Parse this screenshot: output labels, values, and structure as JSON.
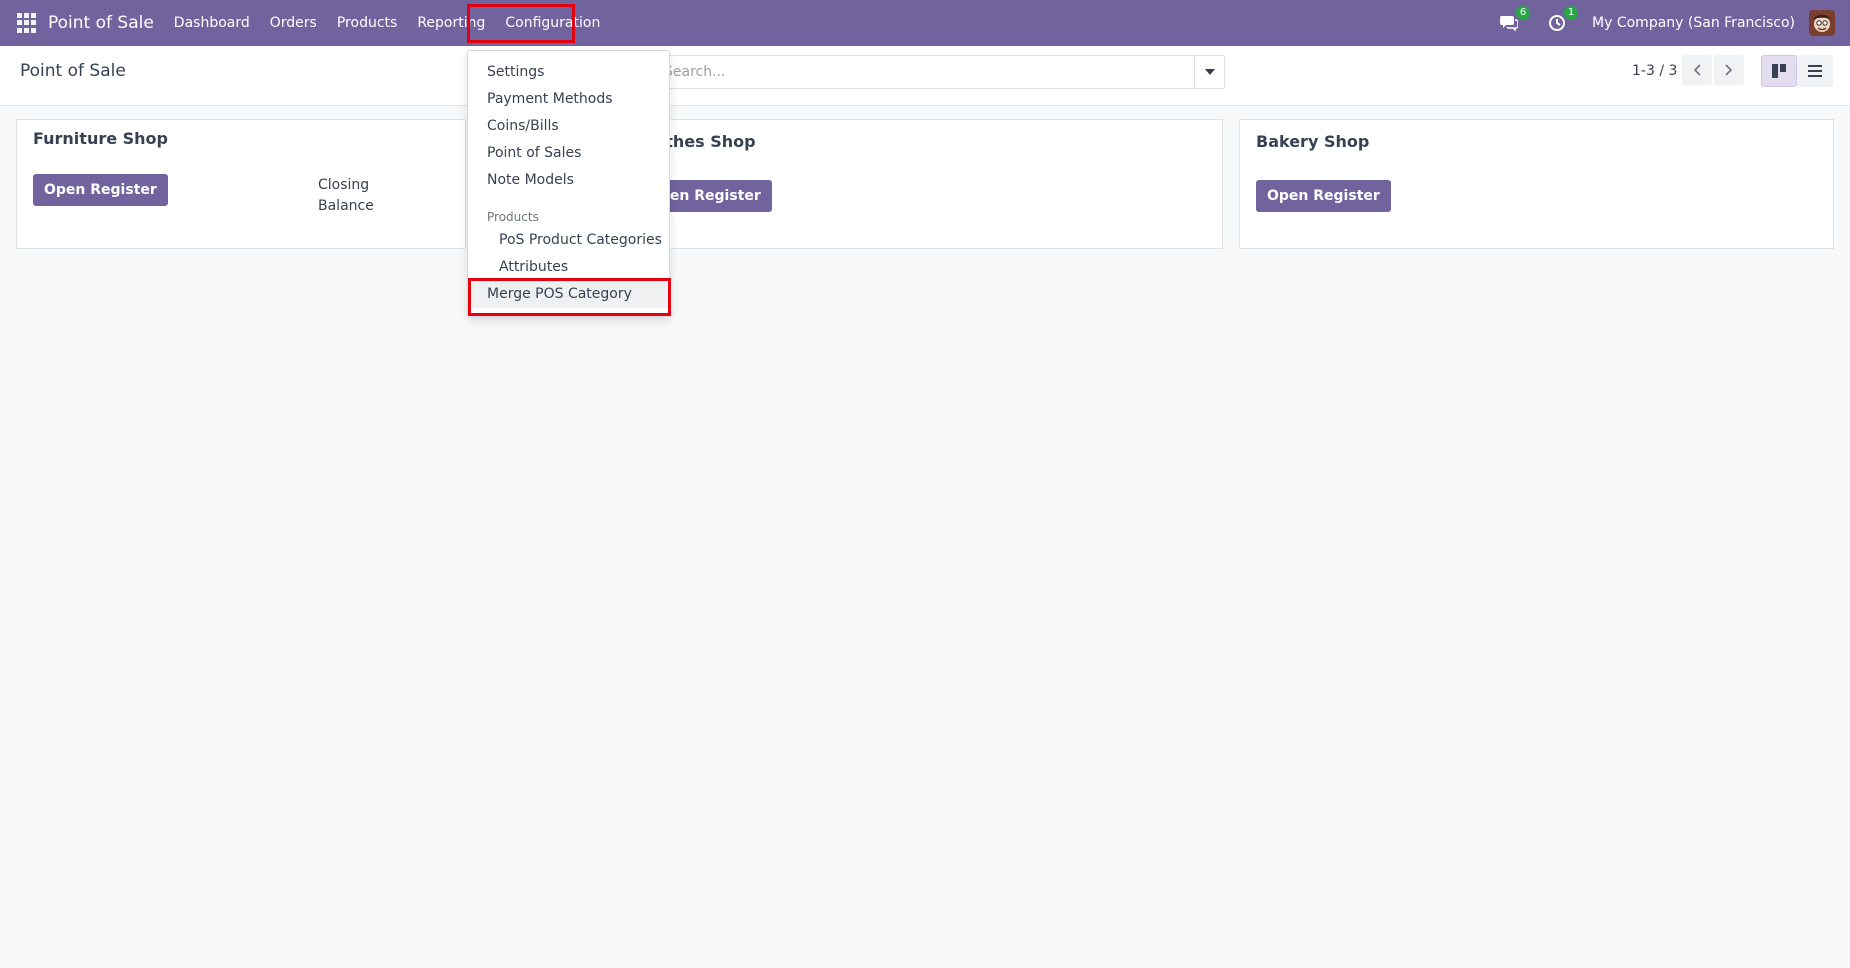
{
  "navbar": {
    "brand": "Point of Sale",
    "menu": [
      "Dashboard",
      "Orders",
      "Products",
      "Reporting",
      "Configuration"
    ],
    "active_menu": "Configuration",
    "messages_badge": "6",
    "activities_badge": "1",
    "company": "My Company (San Francisco)"
  },
  "control_panel": {
    "title": "Point of Sale",
    "search_placeholder": "Search...",
    "pager": "1-3 / 3"
  },
  "cards": [
    {
      "title": "Furniture Shop",
      "button": "Open Register",
      "status_line1": "Closing",
      "status_line2": "Balance"
    },
    {
      "title": "Clothes Shop",
      "button": "Open Register"
    },
    {
      "title": "Bakery Shop",
      "button": "Open Register"
    }
  ],
  "dropdown": {
    "items": [
      "Settings",
      "Payment Methods",
      "Coins/Bills",
      "Point of Sales",
      "Note Models"
    ],
    "section_header": "Products",
    "section_items": [
      "PoS Product Categories",
      "Attributes"
    ],
    "highlighted_item": "Merge POS Category"
  },
  "colors": {
    "brand": "#71639e",
    "highlight": "#e3000f",
    "badge": "#28a745"
  }
}
